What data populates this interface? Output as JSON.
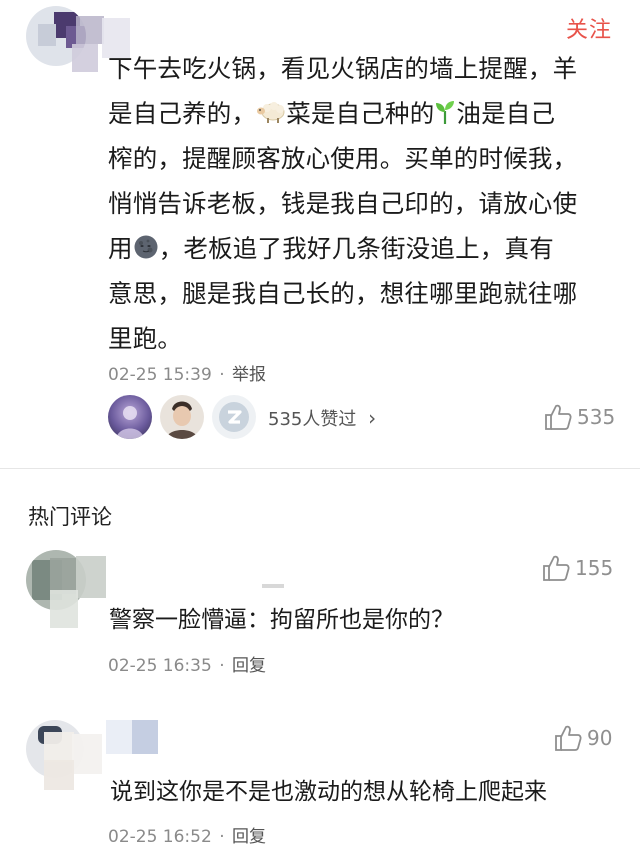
{
  "post": {
    "follow_label": "关注",
    "lines": [
      "下午去吃火锅，看见火锅店的墙上提醒，羊",
      "是自己养的，",
      "菜是自己种的",
      "油是自己",
      "榨的，提醒顾客放心使用。买单的时候我，",
      "悄悄告诉老板，钱是我自己印的，请放心使",
      "用",
      "，老板追了我好几条街没追上，真有",
      "意思，腿是我自己长的，想往哪里跑就往哪",
      "里跑。"
    ],
    "timestamp": "02-25 15:39",
    "separator": "·",
    "report_label": "举报",
    "likers_text": "535人赞过",
    "likers_chevron": "›",
    "like_count": "535"
  },
  "hot": {
    "title": "热门评论",
    "comments": [
      {
        "text": "警察一脸懵逼：拘留所也是你的？",
        "timestamp": "02-25 16:35",
        "separator": "·",
        "reply_label": "回复",
        "likes": "155"
      },
      {
        "text": "说到这你是不是也激动的想从轮椅上爬起来",
        "timestamp": "02-25 16:52",
        "separator": "·",
        "reply_label": "回复",
        "likes": "90"
      }
    ]
  },
  "colors": {
    "accent": "#e8534a",
    "meta": "#8a8a8a",
    "text": "#1b1b1b"
  },
  "icons": {
    "sheep": "sheep-emoji-icon",
    "sprout": "seedling-emoji-icon",
    "moon": "new-moon-face-emoji-icon",
    "thumb": "thumbs-up-icon",
    "chevron": "chevron-right-icon"
  }
}
